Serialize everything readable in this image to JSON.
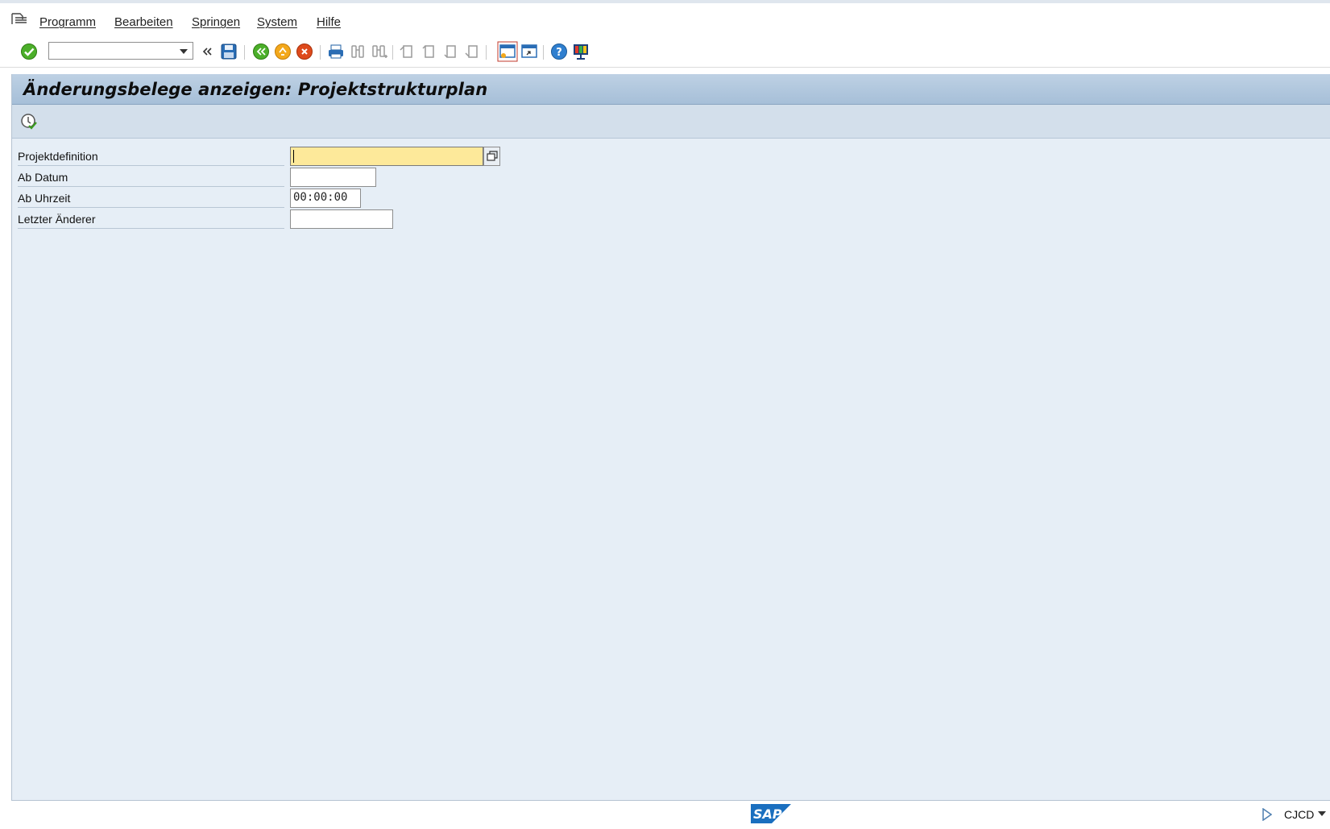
{
  "menu": {
    "items": [
      "Programm",
      "Bearbeiten",
      "Springen",
      "System",
      "Hilfe"
    ]
  },
  "toolbar": {
    "command_field_value": "",
    "icons": [
      "enter-icon",
      "command-field",
      "collapse-icon",
      "save-icon",
      "back-icon",
      "exit-icon",
      "cancel-icon",
      "print-icon",
      "find-icon",
      "find-next-icon",
      "first-page-icon",
      "previous-page-icon",
      "next-page-icon",
      "last-page-icon",
      "new-session-icon",
      "shortcut-icon",
      "help-icon",
      "customize-layout-icon"
    ]
  },
  "page": {
    "title": "Änderungsbelege anzeigen: Projektstrukturplan"
  },
  "form": {
    "fields": [
      {
        "label": "Projektdefinition",
        "value": "",
        "required": true
      },
      {
        "label": "Ab Datum",
        "value": ""
      },
      {
        "label": "Ab Uhrzeit",
        "value": "00:00:00"
      },
      {
        "label": "Letzter Änderer",
        "value": ""
      }
    ]
  },
  "status": {
    "logo": "SAP",
    "tcode": "CJCD"
  },
  "colors": {
    "frame_bg": "#e6eef6",
    "title_bar": "#b3c9df",
    "required_field": "#fde99a",
    "sap_blue": "#1a6fbf"
  }
}
